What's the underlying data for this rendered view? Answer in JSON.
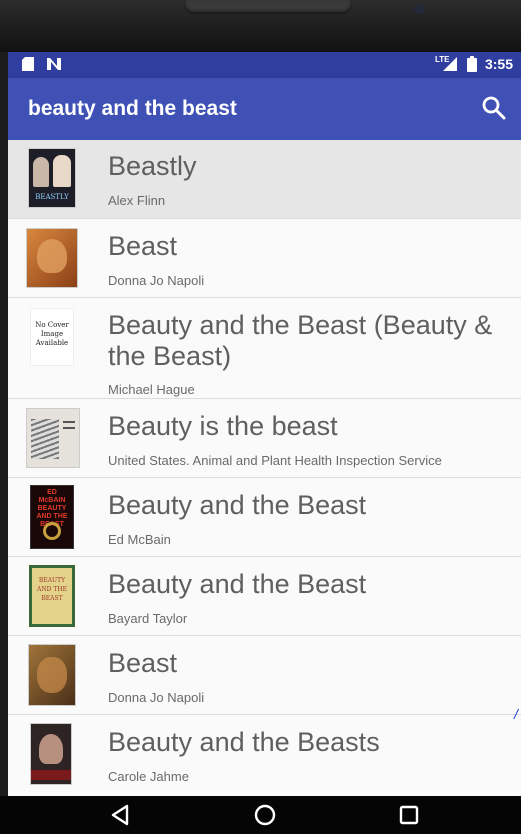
{
  "status_bar": {
    "time": "3:55",
    "network": "LTE",
    "left_icons": [
      "sd-card-icon",
      "n-notification-icon"
    ],
    "right_icons": [
      "signal-icon",
      "battery-icon"
    ]
  },
  "app_bar": {
    "title": "beauty and the beast",
    "action_icon": "search-icon"
  },
  "results": [
    {
      "title": "Beastly",
      "author": "Alex Flinn",
      "selected": true,
      "cover_text": "BEASTLY",
      "cover_bg": "#1e1e28"
    },
    {
      "title": "Beast",
      "author": "Donna Jo Napoli",
      "selected": false,
      "cover_text": "",
      "cover_bg": "#b5662d"
    },
    {
      "title": "Beauty and the Beast (Beauty & the Beast)",
      "author": "Michael Hague",
      "selected": false,
      "cover_text": "No Cover Image Available",
      "cover_bg": "#ffffff"
    },
    {
      "title": "Beauty is the beast",
      "author": "United States. Animal and Plant Health Inspection Service",
      "selected": false,
      "cover_text": "",
      "cover_bg": "#d8d8d0"
    },
    {
      "title": "Beauty and the Beast",
      "author": "Ed McBain",
      "selected": false,
      "cover_text": "ED McBAIN BEAUTY AND THE BEAST",
      "cover_bg": "#2a1010"
    },
    {
      "title": "Beauty and the Beast",
      "author": "Bayard Taylor",
      "selected": false,
      "cover_text": "BEAUTY AND THE BEAST",
      "cover_bg": "#d9c87a"
    },
    {
      "title": "Beast",
      "author": "Donna Jo Napoli",
      "selected": false,
      "cover_text": "",
      "cover_bg": "#8a5a2e"
    },
    {
      "title": "Beauty and the Beasts",
      "author": "Carole Jahme",
      "selected": false,
      "cover_text": "",
      "cover_bg": "#3a2a2a"
    }
  ],
  "nav_bar": {
    "back_icon": "back-triangle-icon",
    "home_icon": "home-circle-icon",
    "recents_icon": "recents-square-icon"
  },
  "colors": {
    "status_bar": "#303f9f",
    "app_bar": "#3f51b5",
    "selected_row": "#e6e6e6",
    "list_bg": "#fafafa"
  }
}
